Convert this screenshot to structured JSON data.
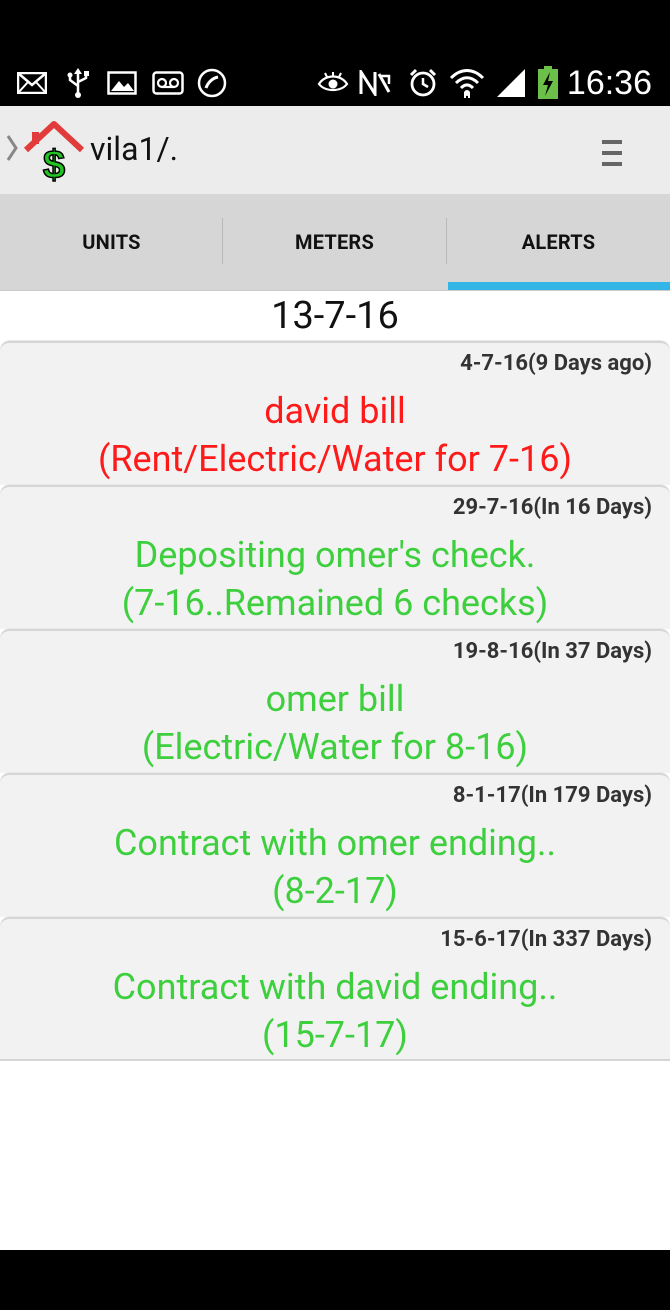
{
  "status_bar": {
    "time": "16:36",
    "left_icons": [
      "mail-icon",
      "usb-icon",
      "image-icon",
      "voicemail-icon",
      "missed-call-icon"
    ],
    "right_icons": [
      "eye-icon",
      "nfc-icon",
      "alarm-icon",
      "wifi-icon",
      "signal-icon",
      "battery-icon"
    ]
  },
  "action_bar": {
    "title": "vila1/.",
    "logo": "house-dollar-logo",
    "menu_icon": "overflow-menu-icon"
  },
  "tabs": [
    {
      "label": "UNITS",
      "selected": false
    },
    {
      "label": "METERS",
      "selected": false
    },
    {
      "label": "ALERTS",
      "selected": true
    }
  ],
  "colors": {
    "accent": "#33b5e5",
    "alert_red": "#ff1a1a",
    "alert_green": "#3ecf3e"
  },
  "alerts": {
    "current_date": "13-7-16",
    "items": [
      {
        "date": "4-7-16(9 Days ago)",
        "line1": "david bill",
        "line2": "(Rent/Electric/Water for 7-16)",
        "color": "#ff1a1a"
      },
      {
        "date": "29-7-16(In 16 Days)",
        "line1": "Depositing omer's check.",
        "line2": "(7-16..Remained 6 checks)",
        "color": "#3ecf3e"
      },
      {
        "date": "19-8-16(In 37 Days)",
        "line1": "omer bill",
        "line2": "(Electric/Water for 8-16)",
        "color": "#3ecf3e"
      },
      {
        "date": "8-1-17(In 179 Days)",
        "line1": "Contract with omer ending..",
        "line2": "(8-2-17)",
        "color": "#3ecf3e"
      },
      {
        "date": "15-6-17(In 337 Days)",
        "line1": "Contract with david ending..",
        "line2": "(15-7-17)",
        "color": "#3ecf3e"
      }
    ]
  }
}
